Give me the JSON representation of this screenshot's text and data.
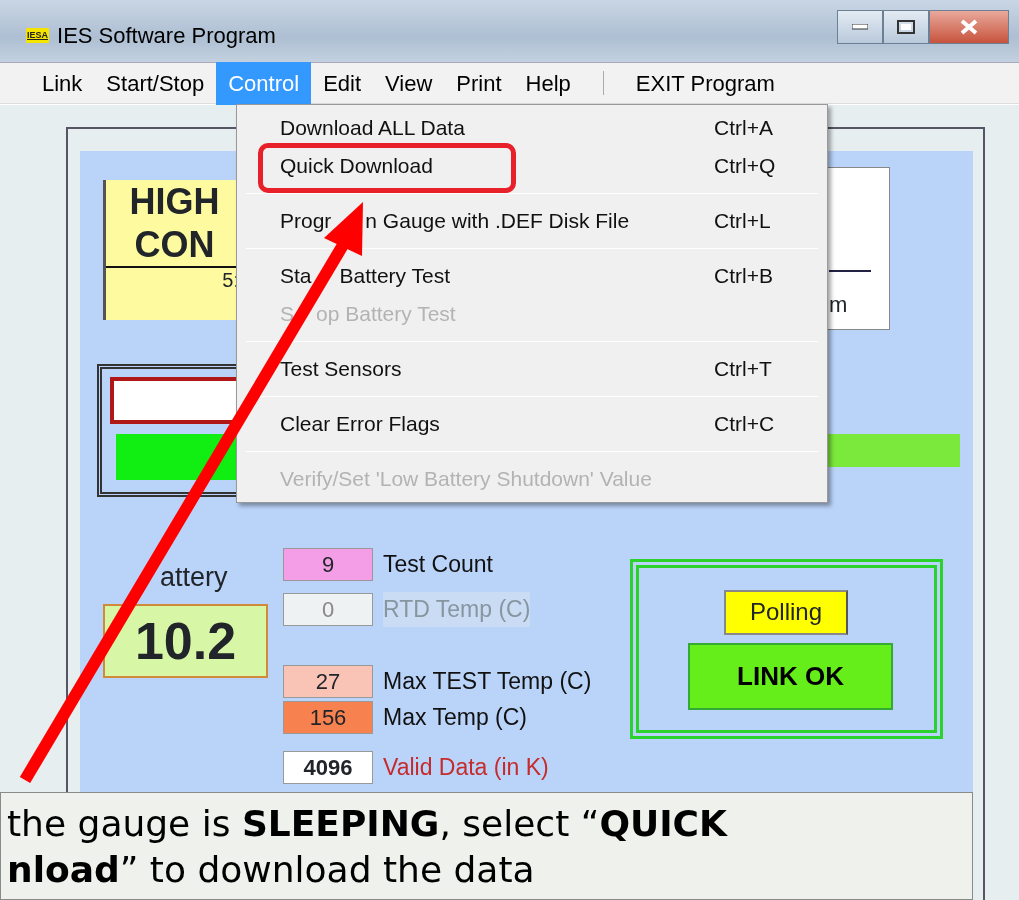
{
  "window": {
    "title": "IES Software Program",
    "logo_text": "IESA"
  },
  "menu_bar": [
    {
      "label": "Link",
      "selected": false
    },
    {
      "label": "Start/Stop",
      "selected": false
    },
    {
      "label": "Control",
      "selected": true
    },
    {
      "label": "Edit",
      "selected": false
    },
    {
      "label": "View",
      "selected": false
    },
    {
      "label": "Print",
      "selected": false
    },
    {
      "label": "Help",
      "selected": false
    },
    {
      "label": "EXIT Program",
      "selected": false
    }
  ],
  "dropdown_groups": [
    [
      {
        "label_parts": [
          "Download ALL Data"
        ],
        "shortcut": "Ctrl+A",
        "disabled": false,
        "annotated": false
      },
      {
        "label_parts": [
          "Quick Download"
        ],
        "shortcut": "Ctrl+Q",
        "disabled": false,
        "annotated": true
      }
    ],
    [
      {
        "label_parts": [
          "Progr",
          "n Gauge with .DEF Disk File"
        ],
        "shortcut": "Ctrl+L",
        "disabled": false,
        "annotated": false
      }
    ],
    [
      {
        "label_parts": [
          "Sta",
          "Battery Test"
        ],
        "shortcut": "Ctrl+B",
        "disabled": false,
        "annotated": false
      },
      {
        "label_parts": [
          "S",
          "op Battery Test"
        ],
        "disabled": true,
        "annotated": false
      }
    ],
    [
      {
        "label_parts": [
          "Test Sensors"
        ],
        "shortcut": "Ctrl+T",
        "disabled": false,
        "annotated": false
      }
    ],
    [
      {
        "label_parts": [
          "Clear Error Flags"
        ],
        "shortcut": "Ctrl+C",
        "disabled": false,
        "annotated": false
      }
    ],
    [
      {
        "label_parts": [
          "Verify/Set 'Low Battery Shutdown' Value"
        ],
        "disabled": true,
        "annotated": false
      }
    ]
  ],
  "status_box": {
    "line_1": "HIGH",
    "line_2": "CON",
    "footer": "5:"
  },
  "right_box": {
    "text": "m"
  },
  "battery": {
    "label": "attery",
    "value": "10.2"
  },
  "fields": [
    {
      "value": "9",
      "label": "Test Count",
      "color": "#f59ee8",
      "disabled": false,
      "alert": false
    },
    {
      "value": "0",
      "label": "RTD Temp (C)",
      "color": "#eef2f2",
      "disabled": true,
      "alert": false
    },
    {
      "value": "27",
      "label": "Max TEST Temp (C)",
      "color": "#f9c3b6",
      "disabled": false,
      "alert": false
    },
    {
      "value": "156",
      "label": "Max Temp (C)",
      "color": "#f7824f",
      "disabled": false,
      "alert": false
    },
    {
      "value": "4096",
      "label": "Valid Data (in K)",
      "color": "#ffffff",
      "disabled": false,
      "alert": true
    }
  ],
  "link_panel": {
    "polling": "Polling",
    "link_status": "LINK OK"
  },
  "callout": {
    "text": "the gauge is **SLEEPING**, select “**QUICK**",
    "text_2": "**nload**” to download the data"
  }
}
